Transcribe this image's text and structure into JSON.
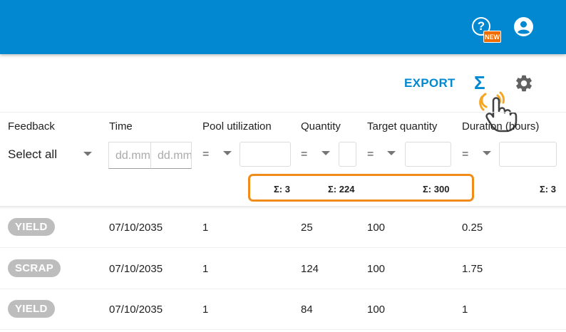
{
  "header": {
    "help_glyph": "?",
    "new_badge": "NEW",
    "account_icon": "account-circle-icon",
    "bar_color": "#0288d1"
  },
  "toolbar": {
    "export_label": "EXPORT",
    "sigma_label": "Σ",
    "settings_icon": "gear-icon",
    "cursor_icon": "hand-pointer-icon"
  },
  "columns": [
    {
      "label": "Feedback"
    },
    {
      "label": "Time"
    },
    {
      "label": "Pool utilization"
    },
    {
      "label": "Quantity"
    },
    {
      "label": "Target quantity"
    },
    {
      "label": "Duration (hours)"
    }
  ],
  "filters": {
    "feedback_value": "Select all",
    "date_from_placeholder": "dd.mm.yyyy",
    "date_to_placeholder": "dd.mm.yyyy",
    "operator": "="
  },
  "sums": {
    "pool_utilization": "Σ: 3",
    "quantity": "Σ: 224",
    "target_quantity": "Σ: 300",
    "duration": "Σ: 3"
  },
  "rows": [
    {
      "feedback": "YIELD",
      "time": "07/10/2035",
      "pool": "1",
      "quantity": "25",
      "target": "100",
      "duration": "0.25"
    },
    {
      "feedback": "SCRAP",
      "time": "07/10/2035",
      "pool": "1",
      "quantity": "124",
      "target": "100",
      "duration": "1.75"
    },
    {
      "feedback": "YIELD",
      "time": "07/10/2035",
      "pool": "1",
      "quantity": "84",
      "target": "100",
      "duration": "1"
    }
  ]
}
